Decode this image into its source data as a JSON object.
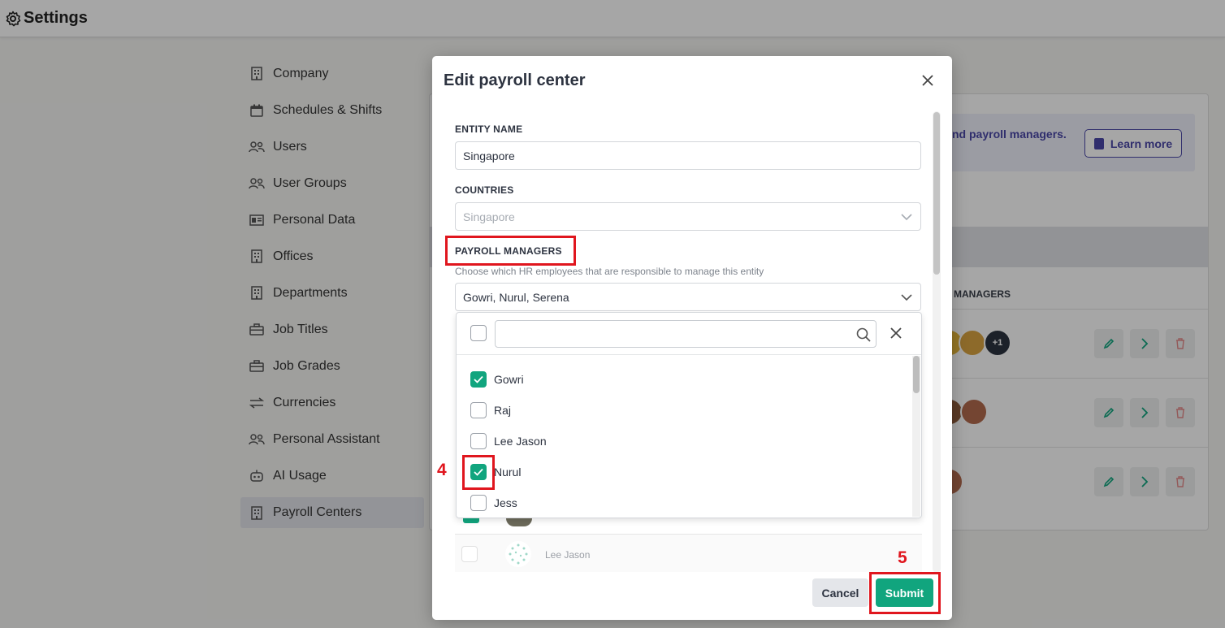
{
  "app": {
    "title": "Settings"
  },
  "sidebar": {
    "items": [
      {
        "label": "Company",
        "icon": "building-icon"
      },
      {
        "label": "Schedules & Shifts",
        "icon": "calendar-icon"
      },
      {
        "label": "Users",
        "icon": "users-icon"
      },
      {
        "label": "User Groups",
        "icon": "users-icon"
      },
      {
        "label": "Personal Data",
        "icon": "id-card-icon"
      },
      {
        "label": "Offices",
        "icon": "building-icon"
      },
      {
        "label": "Departments",
        "icon": "building-icon"
      },
      {
        "label": "Job Titles",
        "icon": "briefcase-icon"
      },
      {
        "label": "Job Grades",
        "icon": "briefcase-icon"
      },
      {
        "label": "Currencies",
        "icon": "exchange-icon"
      },
      {
        "label": "Personal Assistant",
        "icon": "users-icon"
      },
      {
        "label": "AI Usage",
        "icon": "robot-icon"
      },
      {
        "label": "Payroll Centers",
        "icon": "building-icon",
        "active": true
      }
    ]
  },
  "background": {
    "banner_text": "nd payroll managers.",
    "learn_more": "Learn more",
    "col_managers": "MANAGERS",
    "more_count": "+1"
  },
  "modal": {
    "title": "Edit payroll center",
    "entity_name_label": "ENTITY NAME",
    "entity_name_value": "Singapore",
    "countries_label": "COUNTRIES",
    "countries_value": "Singapore",
    "payroll_managers_label": "PAYROLL MANAGERS",
    "payroll_managers_helper": "Choose which HR employees that are responsible to manage this entity",
    "payroll_managers_value": "Gowri, Nurul, Serena",
    "search_placeholder": "",
    "options": [
      {
        "label": "Gowri",
        "checked": true
      },
      {
        "label": "Raj",
        "checked": false
      },
      {
        "label": "Lee Jason",
        "checked": false
      },
      {
        "label": "Nurul",
        "checked": true
      },
      {
        "label": "Jess",
        "checked": false
      }
    ],
    "behind_row_name": "Lee Jason",
    "cancel_label": "Cancel",
    "submit_label": "Submit"
  },
  "annotations": {
    "step4": "4",
    "step5": "5"
  },
  "colors": {
    "accent": "#11a57e",
    "highlight": "#e0161e",
    "brand": "#4a48a8"
  }
}
